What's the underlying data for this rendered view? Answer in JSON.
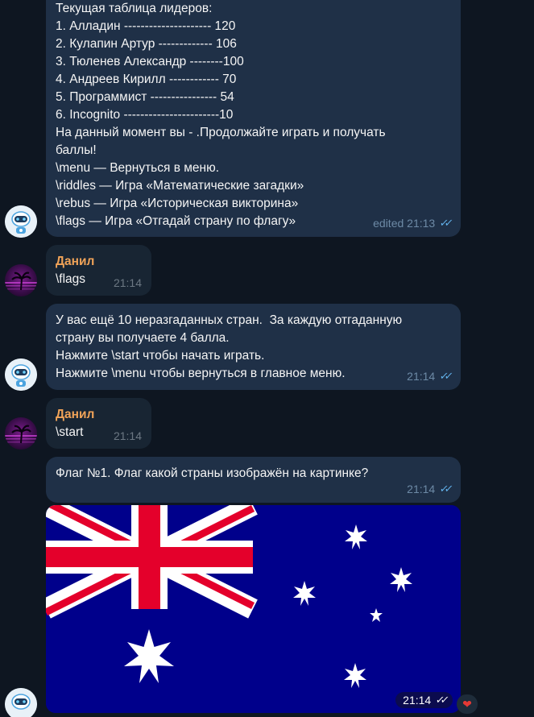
{
  "messages": {
    "leaderboard": {
      "lines": [
        "Текущая таблица лидеров:",
        "1. Алладин --------------------- 120",
        "2. Кулапин Артур ------------- 106",
        "3. Тюленев Александр --------100",
        "4. Андреев Кирилл ------------ 70",
        "5. Программист ---------------- 54",
        "6. Incognito -----------------------10",
        "На данный момент вы - .Продолжайте играть и получать",
        "баллы!",
        "\\menu — Вернуться в меню.",
        "\\riddles — Игра «Математические загадки»",
        "\\rebus — Игра «Историческая викторина»",
        "\\flags — Игра «Отгадай страну по флагу»"
      ],
      "time": "edited 21:13"
    },
    "user_flags": {
      "sender": "Данил",
      "text": "\\flags",
      "time": "21:14"
    },
    "bot_intro": {
      "lines": [
        "У вас ещё 10 неразгаданных стран.  За каждую отгаданную",
        "страну вы получаете 4 балла.",
        "Нажмите \\start чтобы начать играть.",
        "Нажмите \\menu чтобы вернуться в главное меню."
      ],
      "time": "21:14"
    },
    "user_start": {
      "sender": "Данил",
      "text": "\\start",
      "time": "21:14"
    },
    "bot_question": {
      "text": "Флаг №1. Флаг какой страны изображён на картинке?",
      "time": "21:14"
    },
    "flag_image": {
      "icon": "australia-flag",
      "time": "21:14",
      "reaction": "❤"
    }
  },
  "colors": {
    "background": "#0e1621",
    "bot_bubble": "#1f3047",
    "user_bubble": "#182533",
    "sender_name": "#f0a358",
    "read_checks": "#64b5ef",
    "flag_blue": "#00008b",
    "flag_red": "#e4002b"
  }
}
